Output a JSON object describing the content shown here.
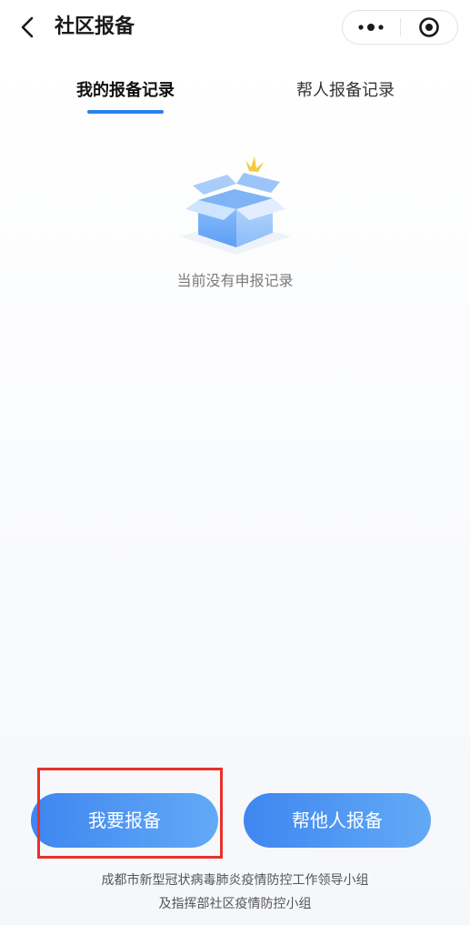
{
  "nav": {
    "title": "社区报备",
    "back_icon": "chevron-left-icon",
    "more_icon": "more-dots-icon",
    "close_icon": "target-close-icon"
  },
  "tabs": [
    {
      "label": "我的报备记录",
      "active": true
    },
    {
      "label": "帮人报备记录",
      "active": false
    }
  ],
  "empty_state": {
    "icon": "empty-box-icon",
    "text": "当前没有申报记录"
  },
  "actions": {
    "self_report_label": "我要报备",
    "help_report_label": "帮他人报备"
  },
  "footer": {
    "line1": "成都市新型冠状病毒肺炎疫情防控工作领导小组",
    "line2": "及指挥部社区疫情防控小组"
  },
  "colors": {
    "accent": "#2b7ff0",
    "button_start": "#3f86f0",
    "button_end": "#62aaf6",
    "highlight": "#e8302a"
  }
}
